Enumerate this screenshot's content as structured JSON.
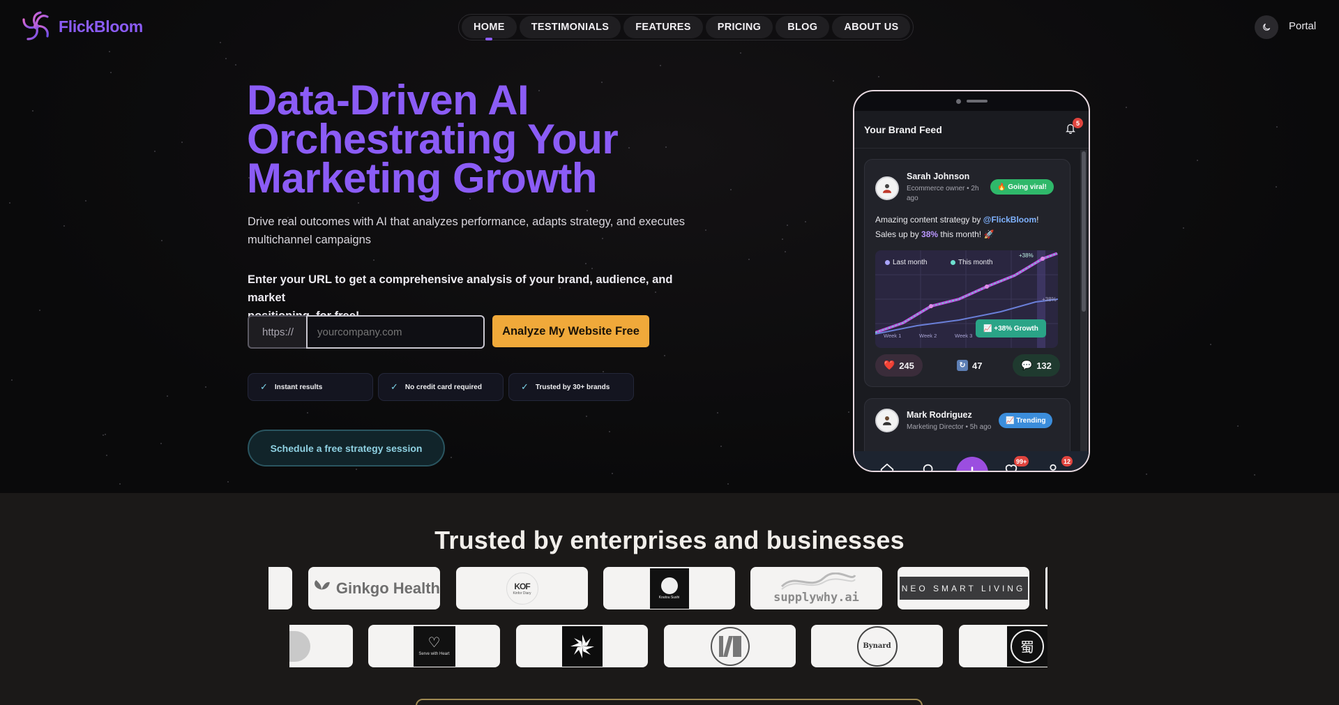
{
  "brand": {
    "name": "FlickBloom"
  },
  "nav": {
    "items": [
      "HOME",
      "TESTIMONIALS",
      "FEATURES",
      "PRICING",
      "BLOG",
      "ABOUT US"
    ],
    "active": "HOME",
    "portal": "Portal",
    "theme_icon": "moon-icon"
  },
  "hero": {
    "headline_line1": "Data-Driven AI",
    "headline_line2": "Orchestrating Your",
    "headline_line3": "Marketing Growth",
    "sub_line1": "Drive real outcomes with AI that analyzes performance, adapts strategy, and executes",
    "sub_line2": "multichannel campaigns",
    "enter_line1": "Enter your URL to get a comprehensive analysis of your brand, audience, and market",
    "enter_line2": "positioning, for free!",
    "url_prefix": "https://",
    "url_placeholder": "yourcompany.com",
    "analyze_button": "Analyze My Website Free",
    "perks": [
      "Instant results",
      "No credit card required",
      "Trusted by 30+ brands"
    ],
    "schedule_button": "Schedule a free strategy session",
    "accent_color": "#8b5cf6",
    "cta_color": "#f0a93a"
  },
  "phone": {
    "feed_title": "Your Brand Feed",
    "notification_count": "5",
    "posts": [
      {
        "name": "Sarah Johnson",
        "role_line1": "Ecommerce owner • 2h",
        "role_line2": "ago",
        "tag": "🔥 Going viral!",
        "text_before": "Amazing content strategy by ",
        "mention": "@FlickBloom",
        "text_mid": "!",
        "text_line2_before": "Sales up by ",
        "pct": "38%",
        "text_line2_after": " this month! 🚀",
        "chart": {
          "legend": [
            "Last month",
            "This month"
          ],
          "weeks": [
            "Week 1",
            "Week 2",
            "Week 3"
          ],
          "top_label": "+38%",
          "side_label": "+38%",
          "growth_badge": "📈 +38% Growth"
        },
        "likes": "245",
        "shares": "47",
        "comments": "132"
      },
      {
        "name": "Mark Rodriguez",
        "role_line1": "Marketing Director • 5h ago",
        "tag": "📈 Trending"
      }
    ],
    "tabbar": {
      "likes_badge": "99+",
      "profile_badge": "12"
    }
  },
  "trusted": {
    "title": "Trusted by enterprises and businesses",
    "row1": [
      "Ginkgo Health",
      "Kinfor Diary",
      "Koutou Sushi",
      "supplywhy.ai",
      "NEO SMART LIVING"
    ],
    "row2": [
      "Serve with Heart",
      "pinwheel",
      "parallel",
      "Bynard",
      "Shufu"
    ]
  }
}
